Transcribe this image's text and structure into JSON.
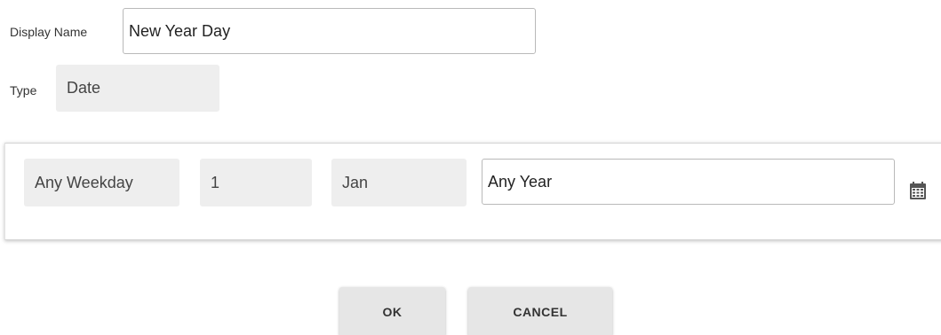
{
  "form": {
    "display_name_label": "Display Name",
    "display_name_value": "New Year Day",
    "type_label": "Type",
    "type_value": "Date"
  },
  "date_rule": {
    "weekday": "Any Weekday",
    "day": "1",
    "month": "Jan",
    "year": "Any Year",
    "calendar_icon": "calendar-icon"
  },
  "actions": {
    "ok_label": "OK",
    "cancel_label": "CANCEL"
  }
}
